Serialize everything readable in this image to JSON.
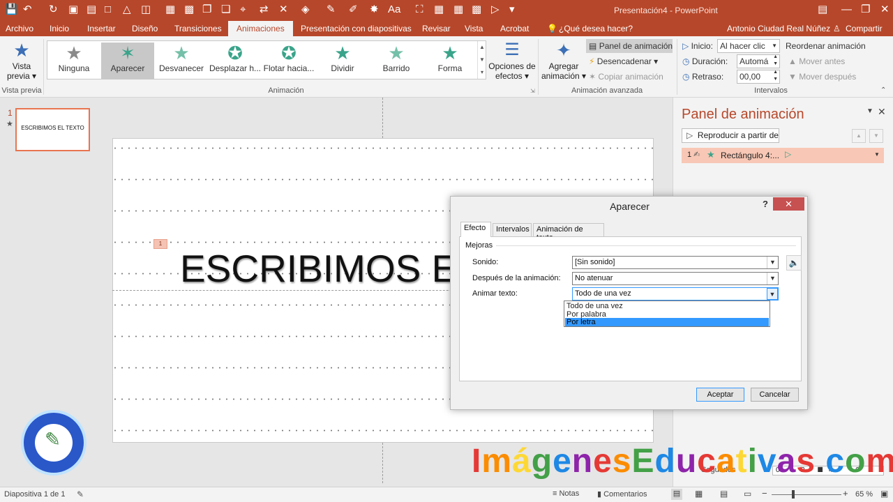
{
  "window": {
    "title": "Presentación4 - PowerPoint",
    "user": "Antonio Ciudad Real Núñez",
    "share_label": "Compartir",
    "tell_me": "¿Qué desea hacer?",
    "quick_access_icons": [
      "save-icon",
      "undo-icon",
      "redo-icon",
      "start-slideshow-icon",
      "layout-icon",
      "textbox-icon",
      "shapes-icon",
      "arrange-icon",
      "picture-icon",
      "font-icon",
      "draw-icon",
      "fill-icon",
      "outline-icon"
    ]
  },
  "tabs": [
    "Archivo",
    "Inicio",
    "Insertar",
    "Diseño",
    "Transiciones",
    "Animaciones",
    "Presentación con diapositivas",
    "Revisar",
    "Vista",
    "Acrobat"
  ],
  "ribbon": {
    "preview": {
      "label_line1": "Vista",
      "label_line2": "previa",
      "group": "Vista previa"
    },
    "gallery": [
      {
        "label": "Ninguna",
        "color": "#8a8a8a"
      },
      {
        "label": "Aparecer",
        "color": "#3aa48a"
      },
      {
        "label": "Desvanecer",
        "color": "#74c0a8"
      },
      {
        "label": "Desplazar h...",
        "color": "#3aa48a"
      },
      {
        "label": "Flotar hacia...",
        "color": "#3aa48a"
      },
      {
        "label": "Dividir",
        "color": "#3aa48a"
      },
      {
        "label": "Barrido",
        "color": "#74c0a8"
      },
      {
        "label": "Forma",
        "color": "#3aa48a"
      }
    ],
    "animation_group": "Animación",
    "effect_options": {
      "line1": "Opciones de",
      "line2": "efectos"
    },
    "add_animation": {
      "line1": "Agregar",
      "line2": "animación"
    },
    "anim_pane_btn": "Panel de animación",
    "trigger_btn": "Desencadenar",
    "copy_anim_btn": "Copiar animación",
    "advanced_group": "Animación avanzada",
    "start_label": "Inicio:",
    "start_value": "Al hacer clic",
    "duration_label": "Duración:",
    "duration_value": "Automá",
    "delay_label": "Retraso:",
    "delay_value": "00,00",
    "reorder_label": "Reordenar animación",
    "move_earlier": "Mover antes",
    "move_later": "Mover después",
    "timing_group": "Intervalos"
  },
  "thumbnail": {
    "number": "1",
    "text": "ESCRIBIMOS EL TEXTO"
  },
  "slide": {
    "text": "ESCRIBIMOS EL",
    "tag": "1"
  },
  "anim_pane": {
    "title": "Panel de animación",
    "play_from": "Reproducir a partir de",
    "item_number": "1",
    "item_label": "Rectángulo 4:...",
    "seconds_label": "Segundos",
    "timeline_ticks": [
      "0",
      "2",
      "4",
      "6"
    ]
  },
  "dialog": {
    "title": "Aparecer",
    "help": "?",
    "tabs": [
      "Efecto",
      "Intervalos",
      "Animación de texto"
    ],
    "section": "Mejoras",
    "sound_label": "Sonido:",
    "sound_value": "[Sin sonido]",
    "after_label": "Después de la animación:",
    "after_value": "No atenuar",
    "animate_label": "Animar texto:",
    "animate_value": "Todo de una vez",
    "options": [
      "Todo de una vez",
      "Por palabra",
      "Por letra"
    ],
    "selected_option": "Por letra",
    "ok": "Aceptar",
    "cancel": "Cancelar"
  },
  "status": {
    "slide_info": "Diapositiva 1 de 1",
    "notes": "Notas",
    "comments": "Comentarios",
    "zoom": "65 %"
  },
  "watermark": {
    "letters": [
      "I",
      "m",
      "á",
      "g",
      "e",
      "n",
      "e",
      "s",
      "E",
      "d",
      "u",
      "c",
      "a",
      "t",
      "i",
      "v",
      "a",
      "s",
      ".",
      "c",
      "o",
      "m"
    ],
    "colors": [
      "#e53935",
      "#fb8c00",
      "#fdd835",
      "#43a047",
      "#1e88e5",
      "#8e24aa",
      "#e53935",
      "#fb8c00",
      "#43a047",
      "#1e88e5",
      "#8e24aa",
      "#e53935",
      "#fb8c00",
      "#fdd835",
      "#43a047",
      "#1e88e5",
      "#8e24aa",
      "#e53935",
      "#333333",
      "#1e88e5",
      "#43a047",
      "#e53935"
    ],
    "badge_text": "http://www.imagenes educativas.com"
  },
  "colors": {
    "accent": "#b7472a",
    "selection": "#3399ff"
  }
}
